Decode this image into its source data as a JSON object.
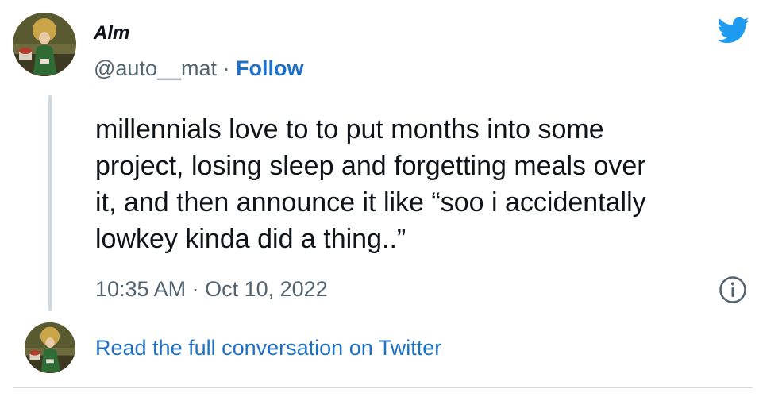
{
  "tweet": {
    "display_name": "Alm",
    "handle": "@auto__mat",
    "separator": " · ",
    "follow_label": "Follow",
    "text": "millennials love to to put months into some\nproject, losing sleep and forgetting meals over\nit, and then announce it like “soo i accidentally\nlowkey kinda did a thing..”",
    "time": "10:35 AM",
    "date": "Oct 10, 2022",
    "read_full_label": "Read the full conversation on Twitter"
  },
  "icons": {
    "brand": "twitter-bird-icon",
    "info": "info-icon",
    "avatar": "avatar"
  },
  "colors": {
    "link": "#1d71c9",
    "brand_blue": "#1d9bf0",
    "text_primary": "#0f1419",
    "text_secondary": "#536471",
    "divider": "#cfd9de"
  }
}
